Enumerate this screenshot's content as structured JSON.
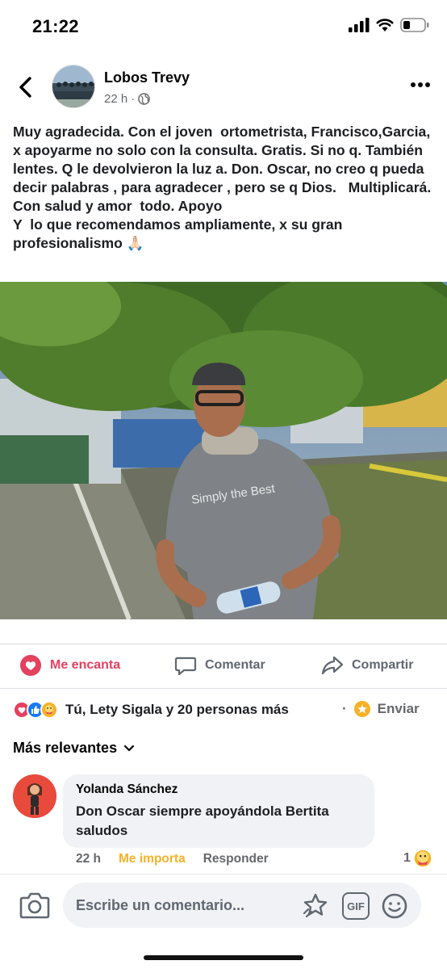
{
  "status": {
    "time": "21:22"
  },
  "header": {
    "page_name": "Lobos Trevy",
    "time_ago": "22 h",
    "separator": "·",
    "audience_icon": "globe-icon"
  },
  "post": {
    "text": "Muy agradecida. Con el joven  ortometrista, Francisco,Garcia, x apoyarme no solo con la consulta. Gratis. Si no q. También lentes. Q le devolvieron la luz a. Don. Oscar, no creo q pueda decir palabras , para agradecer , pero se q Dios.   Multiplicará. Con salud y amor  todo. Apoyo\nY  lo que recomendamos ampliamente, x su gran profesionalismo 🙏🏻",
    "photo_shirt_text": "Simply the Best"
  },
  "actions": {
    "love_label": "Me encanta",
    "comment_label": "Comentar",
    "share_label": "Compartir"
  },
  "reactions": {
    "summary": "Tú, Lety Sigala y 20 personas más",
    "dot": "·",
    "send_label": "Enviar"
  },
  "comments": {
    "sort_label": "Más relevantes",
    "items": [
      {
        "author": "Yolanda Sánchez",
        "text": "Don Oscar siempre apoyándola Bertita saludos",
        "time": "22 h",
        "reaction_label": "Me importa",
        "reply_label": "Responder",
        "reaction_count": "1"
      }
    ]
  },
  "composer": {
    "placeholder": "Escribe un comentario...",
    "gif_label": "GIF"
  },
  "colors": {
    "love": "#e4405f",
    "like": "#1877f2",
    "care": "#f7b125",
    "text_secondary": "#65676b"
  }
}
